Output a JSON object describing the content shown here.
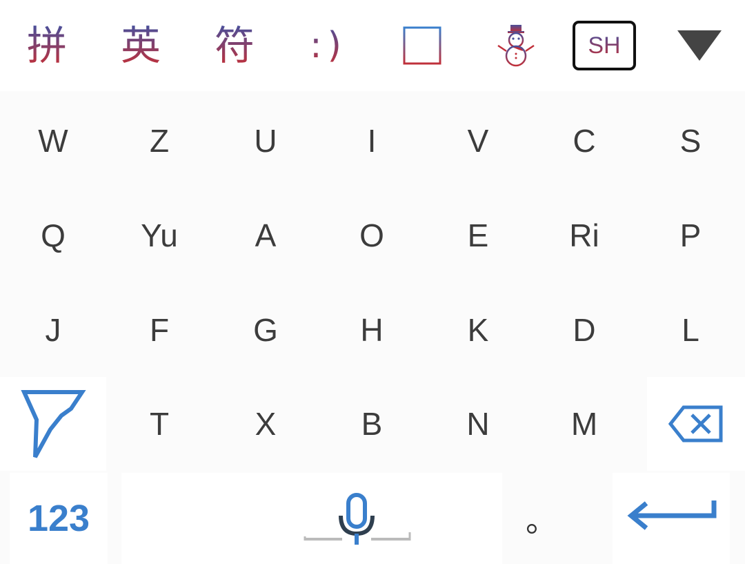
{
  "toolbar": {
    "pinyin_label": "拼",
    "english_label": "英",
    "symbol_label": "符",
    "emoticon_label": ":)",
    "layout_badge": "SH",
    "colors": {
      "gradient_top": "#4a4f9a",
      "gradient_bottom": "#c0303a",
      "accent": "#3a7fcc"
    },
    "icons": [
      "clipboard-icon",
      "snowman-icon",
      "collapse-keyboard-icon"
    ]
  },
  "rows": {
    "row1": [
      "W",
      "Z",
      "U",
      "I",
      "V",
      "C",
      "S"
    ],
    "row2": [
      "Q",
      "Yu",
      "A",
      "O",
      "E",
      "Ri",
      "P"
    ],
    "row3": [
      "J",
      "F",
      "G",
      "H",
      "K",
      "D",
      "L"
    ],
    "row4": [
      "T",
      "X",
      "B",
      "N",
      "M"
    ]
  },
  "bottom": {
    "number_key": "123",
    "comma": "，",
    "period": "。"
  }
}
